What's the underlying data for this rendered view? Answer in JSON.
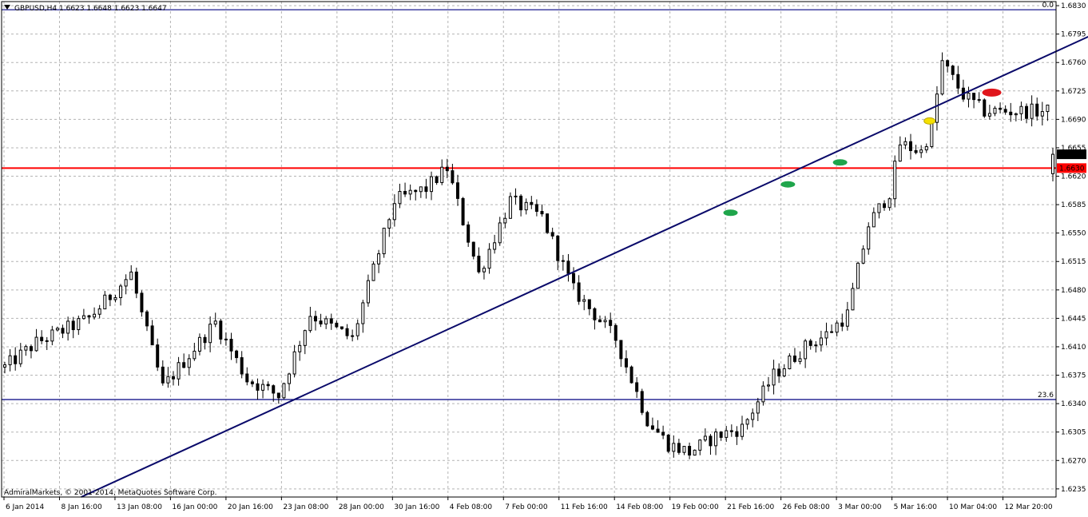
{
  "window": {
    "title_icon": "collapse-triangle-icon",
    "symbol_header": "GBPUSD,H4  1.6623 1.6648 1.6623 1.6647",
    "copyright": "AdmiralMarkets, © 2001-2014, MetaQuotes Software Corp."
  },
  "colors": {
    "background": "#ffffff",
    "grid": "#b4b4b4",
    "candles": "#000000",
    "fib_lines": "#000080",
    "trend_line": "#0a0a6a",
    "support_line": "#ff0000",
    "price_label_current_bg": "#000000",
    "price_label_support_bg": "#ff0000",
    "marker_green": "#1fa54b",
    "marker_yellow": "#f5e000",
    "marker_red": "#e0161c"
  },
  "chart_data": {
    "type": "candlestick",
    "symbol": "GBPUSD",
    "timeframe": "H4",
    "ohlc_header": {
      "open": 1.6623,
      "high": 1.6648,
      "low": 1.6623,
      "close": 1.6647
    },
    "ylim": [
      1.6225,
      1.6835
    ],
    "y_ticks": [
      "1.6830",
      "1.6795",
      "1.6760",
      "1.6725",
      "1.6690",
      "1.6655",
      "1.6620",
      "1.6585",
      "1.6550",
      "1.6515",
      "1.6480",
      "1.6445",
      "1.6410",
      "1.6375",
      "1.6340",
      "1.6305",
      "1.6270",
      "1.6235"
    ],
    "x_ticks": [
      "6 Jan 2014",
      "8 Jan 16:00",
      "13 Jan 08:00",
      "16 Jan 00:00",
      "20 Jan 16:00",
      "23 Jan 08:00",
      "28 Jan 00:00",
      "30 Jan 16:00",
      "4 Feb 08:00",
      "7 Feb 00:00",
      "11 Feb 16:00",
      "14 Feb 08:00",
      "19 Feb 00:00",
      "21 Feb 16:00",
      "26 Feb 08:00",
      "3 Mar 00:00",
      "5 Mar 16:00",
      "10 Mar 04:00",
      "12 Mar 20:00"
    ],
    "bar_count": 200,
    "anchors": [
      [
        0,
        1.6385
      ],
      [
        6,
        1.6415
      ],
      [
        16,
        1.6445
      ],
      [
        24,
        1.65
      ],
      [
        26,
        1.645
      ],
      [
        30,
        1.636
      ],
      [
        40,
        1.644
      ],
      [
        46,
        1.637
      ],
      [
        52,
        1.635
      ],
      [
        58,
        1.645
      ],
      [
        66,
        1.642
      ],
      [
        74,
        1.659
      ],
      [
        80,
        1.6605
      ],
      [
        84,
        1.663
      ],
      [
        90,
        1.65
      ],
      [
        96,
        1.659
      ],
      [
        102,
        1.657
      ],
      [
        108,
        1.648
      ],
      [
        116,
        1.642
      ],
      [
        122,
        1.632
      ],
      [
        126,
        1.629
      ],
      [
        130,
        1.628
      ],
      [
        135,
        1.63
      ],
      [
        140,
        1.631
      ],
      [
        146,
        1.6375
      ],
      [
        152,
        1.641
      ],
      [
        156,
        1.6425
      ],
      [
        160,
        1.645
      ],
      [
        164,
        1.656
      ],
      [
        168,
        1.66
      ],
      [
        170,
        1.666
      ],
      [
        174,
        1.665
      ],
      [
        176,
        1.668
      ],
      [
        178,
        1.676
      ],
      [
        182,
        1.672
      ],
      [
        186,
        1.67
      ]
    ],
    "levels": [
      {
        "name": "fib-0",
        "label": "0.0",
        "price": 1.6825
      },
      {
        "name": "fib-23-6",
        "label": "23.6",
        "price": 1.6345
      },
      {
        "name": "support",
        "label": "1.6630",
        "price": 1.663
      }
    ],
    "current_price": "1.6647",
    "support_price": "1.6630",
    "trendline": {
      "start": {
        "bar": 14.5,
        "price": 1.6225
      },
      "end": {
        "bar": 206.8,
        "price": 1.6795
      }
    },
    "markers": [
      {
        "name": "green-touch-1",
        "color": "green",
        "bar": 137.8,
        "price": 1.6575
      },
      {
        "name": "green-touch-2",
        "color": "green",
        "bar": 148.7,
        "price": 1.661
      },
      {
        "name": "green-touch-3",
        "color": "green",
        "bar": 158.6,
        "price": 1.6637
      },
      {
        "name": "yellow-break",
        "color": "yellow",
        "bar": 175.6,
        "price": 1.6688
      },
      {
        "name": "red-retest",
        "color": "red",
        "bar": 187.4,
        "price": 1.6723
      }
    ]
  }
}
